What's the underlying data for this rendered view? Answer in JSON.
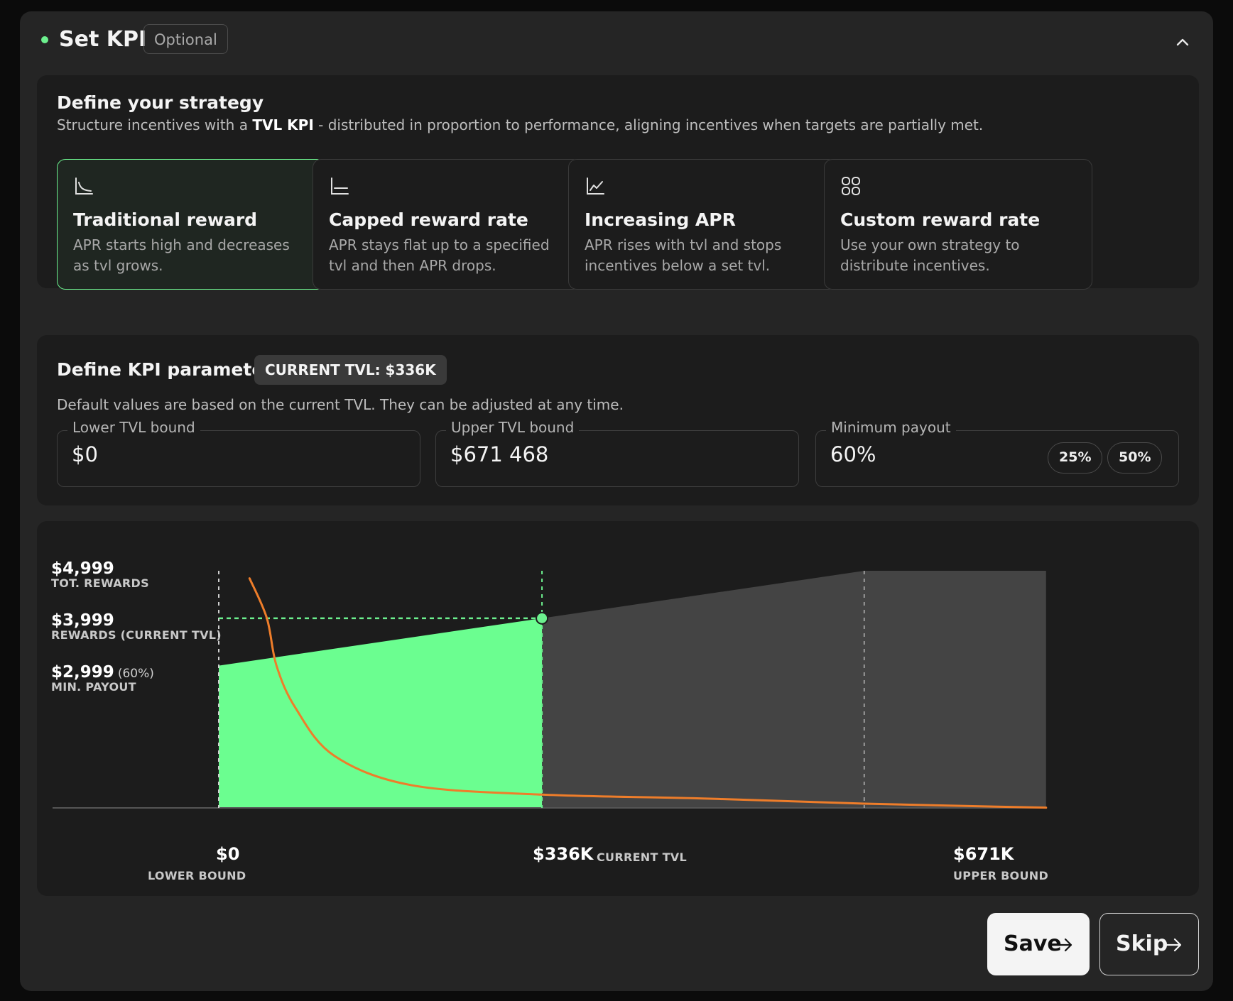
{
  "header": {
    "title": "Set KPI",
    "badge": "Optional"
  },
  "strategy": {
    "title": "Define your strategy",
    "subtitle_pre": "Structure incentives with a ",
    "subtitle_bold": "TVL KPI",
    "subtitle_post": " - distributed in proportion to performance, aligning incentives when targets are partially met.",
    "options": [
      {
        "title": "Traditional reward",
        "desc": "APR starts high and decreases as tvl grows.",
        "icon": "chart-decreasing-icon",
        "selected": true
      },
      {
        "title": "Capped reward rate",
        "desc": "APR stays flat up to a specified tvl and then APR drops.",
        "icon": "chart-flat-icon",
        "selected": false
      },
      {
        "title": "Increasing APR",
        "desc": "APR rises with tvl and stops incentives below a set tvl.",
        "icon": "chart-increasing-icon",
        "selected": false
      },
      {
        "title": "Custom reward rate",
        "desc": "Use your own strategy to distribute incentives.",
        "icon": "grid-icon",
        "selected": false
      }
    ]
  },
  "params": {
    "title": "Define KPI parameters",
    "badge": "CURRENT TVL: $336K",
    "subtitle": "Default values are based on the current TVL. They can be adjusted at any time.",
    "lower": {
      "label": "Lower TVL bound",
      "value": "$0"
    },
    "upper": {
      "label": "Upper TVL bound",
      "value": "$671 468"
    },
    "min_payout": {
      "label": "Minimum payout",
      "value": "60%",
      "pills": [
        "25%",
        "50%"
      ]
    }
  },
  "chart_labels": {
    "y": [
      {
        "value": "$4,999",
        "sub": "TOT. REWARDS",
        "pct": ""
      },
      {
        "value": "$3,999",
        "sub": "REWARDS (CURRENT TVL)",
        "pct": ""
      },
      {
        "value": "$2,999",
        "sub": "MIN. PAYOUT",
        "pct": "(60%)"
      }
    ],
    "x": [
      {
        "value": "$0",
        "sub": "LOWER BOUND"
      },
      {
        "value": "$336K",
        "sub": "CURRENT TVL"
      },
      {
        "value": "$671K",
        "sub": "UPPER BOUND"
      }
    ]
  },
  "chart_data": {
    "type": "area",
    "x_unit": "TVL ($)",
    "y_unit": "Rewards ($)",
    "xlim": [
      0,
      886000
    ],
    "ylim": [
      0,
      4999
    ],
    "tick_values": {
      "lower_bound": 0,
      "current_tvl": 336000,
      "upper_bound": 671000
    },
    "series": [
      {
        "name": "rewards",
        "x": [
          0,
          336000,
          671000,
          860000
        ],
        "y": [
          2999,
          3999,
          4999,
          4999
        ]
      },
      {
        "name": "apr",
        "x": [
          32000,
          50000,
          60000,
          80000,
          120000,
          200000,
          336000,
          500000,
          671000,
          860000
        ],
        "y": [
          4840,
          4000,
          3000,
          2100,
          1100,
          480,
          280,
          200,
          90,
          5
        ]
      }
    ],
    "colors": {
      "achieved": "#6bfe90",
      "remaining": "#444444",
      "apr_curve": "#ee7d2a",
      "marker": "#6cf08e"
    }
  },
  "buttons": {
    "save": "Save",
    "skip": "Skip"
  }
}
